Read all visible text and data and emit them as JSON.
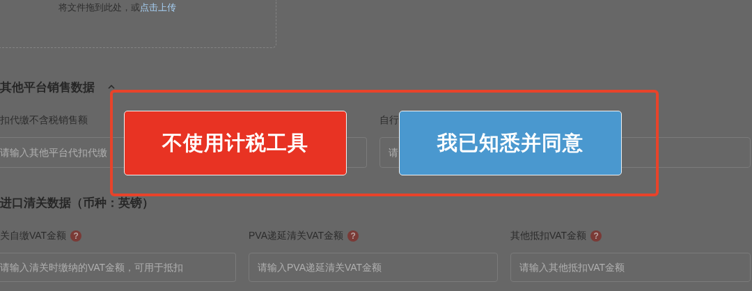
{
  "upload": {
    "text": "将文件拖到此处，或",
    "link": "点击上传"
  },
  "sections": [
    {
      "title": "其他平台销售数据",
      "expanded": true,
      "fields": [
        {
          "label": "扣代缴不含税销售额",
          "placeholder": "请输入其他平台代扣代缴"
        },
        {
          "label": "自行",
          "placeholder": "请"
        }
      ]
    },
    {
      "title": "进口清关数据（币种：英镑）",
      "fields": [
        {
          "label": "关自缴VAT金额",
          "help": "?",
          "placeholder": "请输入清关时缴纳的VAT金额，可用于抵扣"
        },
        {
          "label": "PVA递延清关VAT金额",
          "help": "?",
          "placeholder": "请输入PVA递延清关VAT金额"
        },
        {
          "label": "其他抵扣VAT金额",
          "help": "?",
          "placeholder": "请输入其他抵扣VAT金额"
        }
      ]
    }
  ],
  "dialog": {
    "buttons": [
      {
        "label": "不使用计税工具",
        "kind": "danger"
      },
      {
        "label": "我已知悉并同意",
        "kind": "primary"
      }
    ]
  }
}
